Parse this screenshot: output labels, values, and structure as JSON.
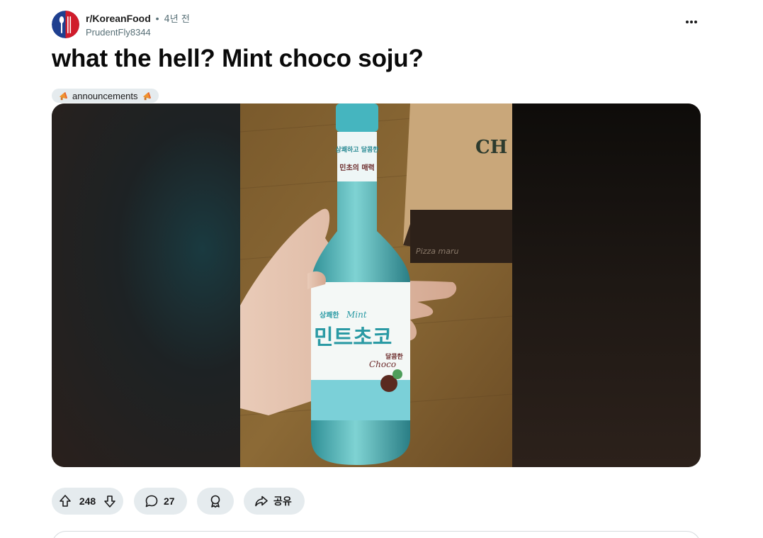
{
  "post": {
    "subreddit": "r/KoreanFood",
    "separator": "•",
    "time": "4년 전",
    "author": "PrudentFly8344",
    "title": "what the hell? Mint choco soju?",
    "flair": "announcements",
    "more_icon": "more-horizontal-icon"
  },
  "actions": {
    "upvotes": "248",
    "comments": "27",
    "share_label": "공유"
  },
  "image": {
    "bottle_label_line1": "상쾌하고 달콤한",
    "bottle_label_line2": "민초의 매력",
    "bottle_brand_small": "상쾌한",
    "bottle_brand_script": "Mint",
    "bottle_main": "민트초코",
    "bottle_sub": "달콤한",
    "bottle_choco": "Choco",
    "box_text": "CH",
    "box_side_text": "Pizza maru"
  },
  "colors": {
    "pill_bg": "#e5ebee",
    "title": "#0a0a0a",
    "meta": "#576f76",
    "bottle_mint": "#3fb0b5"
  }
}
